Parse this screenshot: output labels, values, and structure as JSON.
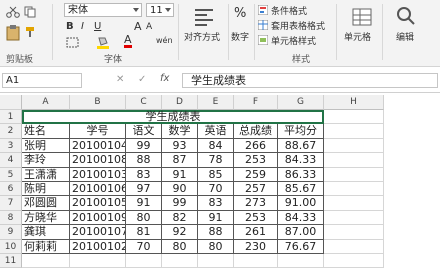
{
  "ribbon": {
    "clipboard": {
      "cut_icon": "scissors-icon",
      "copy_icon": "copy-icon",
      "paste_icon": "paste-icon",
      "format_painter_icon": "brush-icon",
      "label": "剪贴板"
    },
    "font": {
      "name": "宋体",
      "size": "11",
      "label": "字体",
      "bold": "B",
      "italic": "I",
      "underline": "U",
      "grow": "A",
      "shrink": "A",
      "font_color": "A",
      "wen": "wén"
    },
    "alignment": {
      "label": "对齐方式"
    },
    "number": {
      "label": "数字",
      "percent": "%"
    },
    "styles": {
      "conditional": "条件格式",
      "table_format": "套用表格格式",
      "cell_style": "单元格样式",
      "label": "样式"
    },
    "cells": {
      "label": "单元格"
    },
    "editing": {
      "label": "编辑"
    }
  },
  "formula_bar": {
    "name_box": "A1",
    "cancel": "✕",
    "enter": "✓",
    "fx": "fx",
    "content": "学生成绩表"
  },
  "columns": [
    "A",
    "B",
    "C",
    "D",
    "E",
    "F",
    "G",
    "H"
  ],
  "rows": [
    "1",
    "2",
    "3",
    "4",
    "5",
    "6",
    "7",
    "8",
    "9",
    "10",
    "11"
  ],
  "sheet": {
    "title": "学生成绩表",
    "headers": [
      "姓名",
      "学号",
      "语文",
      "数学",
      "英语",
      "总成绩",
      "平均分"
    ],
    "data": [
      [
        "张明",
        "20100104",
        "99",
        "93",
        "84",
        "266",
        "88.67"
      ],
      [
        "李玲",
        "20100108",
        "88",
        "87",
        "78",
        "253",
        "84.33"
      ],
      [
        "王潇潇",
        "20100103",
        "83",
        "91",
        "85",
        "259",
        "86.33"
      ],
      [
        "陈明",
        "20100106",
        "97",
        "90",
        "70",
        "257",
        "85.67"
      ],
      [
        "邓圆圆",
        "20100105",
        "91",
        "99",
        "83",
        "273",
        "91.00"
      ],
      [
        "方晓华",
        "20100109",
        "80",
        "82",
        "91",
        "253",
        "84.33"
      ],
      [
        "龚琪",
        "20100107",
        "81",
        "92",
        "88",
        "261",
        "87.00"
      ],
      [
        "何莉莉",
        "20100102",
        "70",
        "80",
        "80",
        "230",
        "76.67"
      ]
    ]
  }
}
